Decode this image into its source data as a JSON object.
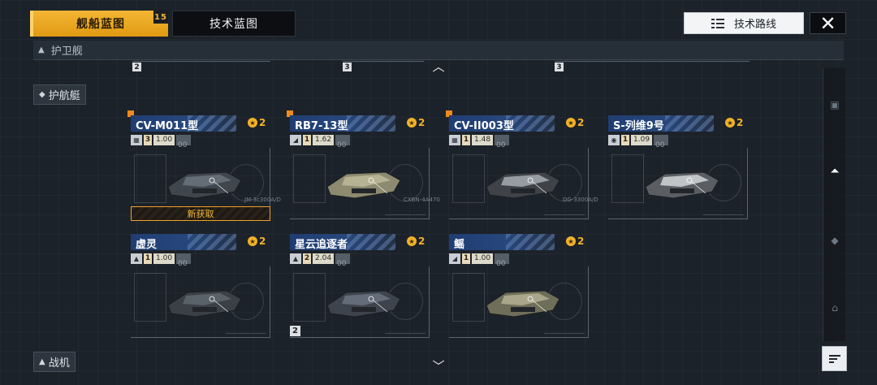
{
  "tabs": {
    "ship_blueprint": "舰船蓝图",
    "ship_blueprint_badge": "15",
    "tech_blueprint": "技术蓝图"
  },
  "top_right": {
    "route_label": "技术路线",
    "close_label": "✕"
  },
  "category": {
    "current": "护卫舰",
    "side_items": [
      "护航艇",
      "战机"
    ]
  },
  "ruler_numbers": [
    "2",
    "3",
    "3"
  ],
  "cards": [
    {
      "name": "CV-M011型",
      "rank": "2",
      "tier": "3",
      "value": "1.00",
      "value_tail": "00",
      "is_new": true,
      "new_label": "新获取",
      "type_icon": "grid-icon",
      "tag": "JM-3c300A/D"
    },
    {
      "name": "RB7-13型",
      "rank": "2",
      "tier": "1",
      "value": "1.62",
      "value_tail": "00",
      "is_new": true,
      "new_label": "",
      "type_icon": "slash-icon",
      "tag": "CXBN-4A470"
    },
    {
      "name": "CV-II003型",
      "rank": "2",
      "tier": "1",
      "value": "1.48",
      "value_tail": "00",
      "is_new": true,
      "new_label": "",
      "type_icon": "grid-icon",
      "tag": "DG-3300A/D"
    },
    {
      "name": "S-列维9号",
      "rank": "2",
      "tier": "1",
      "value": "1.09",
      "value_tail": "00",
      "is_new": false,
      "new_label": "",
      "type_icon": "orb-icon",
      "tag": ""
    },
    {
      "name": "虚灵",
      "rank": "2",
      "tier": "1",
      "value": "1.00",
      "value_tail": "00",
      "is_new": false,
      "new_label": "",
      "type_icon": "pin-icon",
      "tag": ""
    },
    {
      "name": "星云追逐者",
      "rank": "2",
      "tier": "2",
      "value": "2.04",
      "value_tail": "00",
      "is_new": false,
      "new_label": "",
      "type_icon": "pin-icon",
      "tag": ""
    },
    {
      "name": "鳐",
      "rank": "2",
      "tier": "1",
      "value": "1.00",
      "value_tail": "00",
      "is_new": false,
      "new_label": "",
      "type_icon": "slash-icon",
      "tag": ""
    }
  ],
  "footer_tag": "2",
  "colors": {
    "accent": "#f3b634",
    "card_title": "#1f3d72",
    "new_flag": "#f08a1c"
  }
}
